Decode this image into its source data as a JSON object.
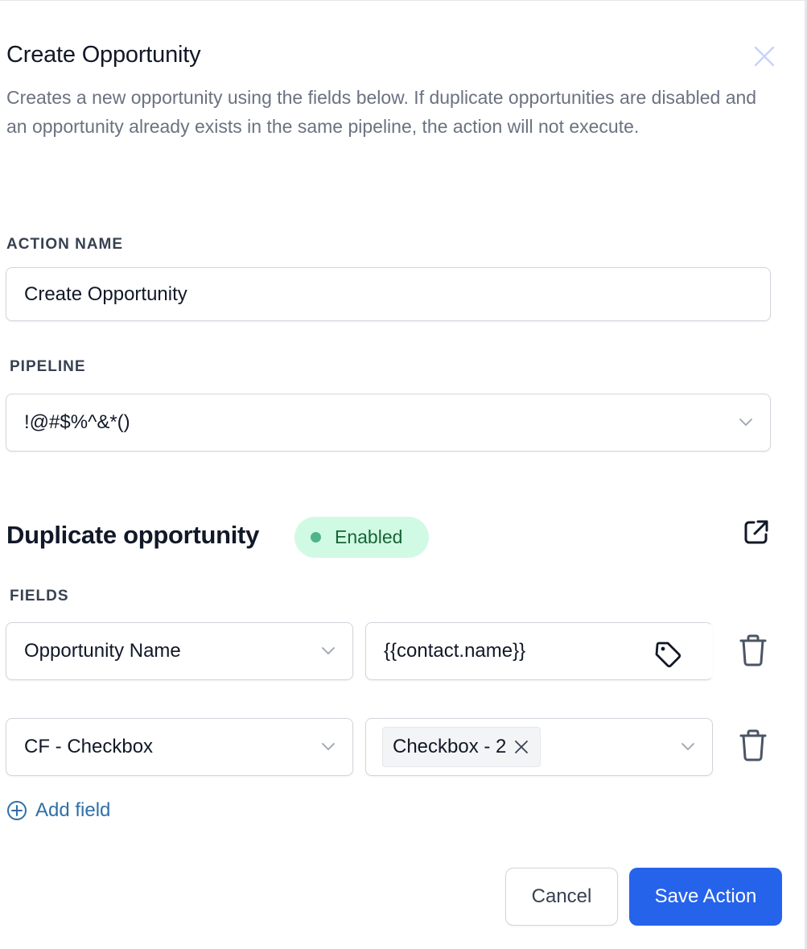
{
  "modal": {
    "title": "Create Opportunity",
    "description": "Creates a new opportunity using the fields below. If duplicate opportunities are disabled and an opportunity already exists in the same pipeline, the action will not execute."
  },
  "action_name": {
    "label": "ACTION NAME",
    "value": "Create Opportunity"
  },
  "pipeline": {
    "label": "PIPELINE",
    "value": "!@#$%^&*()"
  },
  "duplicate": {
    "title": "Duplicate opportunity",
    "status": "Enabled",
    "status_color": "#4fb589"
  },
  "fields": {
    "label": "FIELDS",
    "rows": [
      {
        "field": "Opportunity Name",
        "value": "{{contact.name}}"
      },
      {
        "field": "CF - Checkbox",
        "chip": "Checkbox - 2"
      }
    ],
    "add_label": "Add field"
  },
  "footer": {
    "cancel_label": "Cancel",
    "save_label": "Save Action",
    "save_color": "#2563eb"
  },
  "icons": {
    "close": "close-icon",
    "chevron": "chevron-down-icon",
    "external": "external-link-icon",
    "tag": "tag-icon",
    "trash": "trash-icon",
    "plus": "plus-circle-icon"
  }
}
